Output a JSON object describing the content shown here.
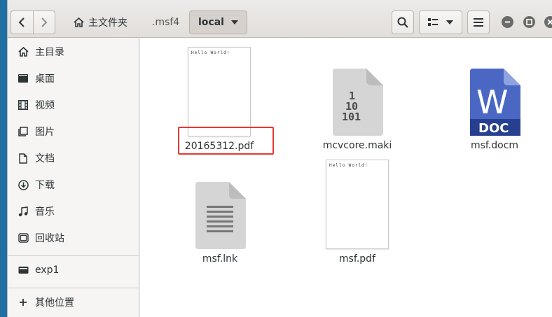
{
  "header": {
    "home_label": "主文件夹",
    "crumb_parent": ".msf4",
    "crumb_current": "local"
  },
  "sidebar": {
    "items": [
      {
        "label": "主目录",
        "icon": "home-icon"
      },
      {
        "label": "桌面",
        "icon": "desktop-icon"
      },
      {
        "label": "视频",
        "icon": "video-icon"
      },
      {
        "label": "图片",
        "icon": "picture-icon"
      },
      {
        "label": "文档",
        "icon": "document-icon"
      },
      {
        "label": "下载",
        "icon": "download-icon"
      },
      {
        "label": "音乐",
        "icon": "music-icon"
      },
      {
        "label": "回收站",
        "icon": "trash-icon"
      },
      {
        "label": "exp1",
        "icon": "drive-icon"
      },
      {
        "label": "其他位置",
        "icon": "plus-icon"
      }
    ]
  },
  "files": [
    {
      "name": "20165312.pdf",
      "type": "pdf",
      "thumb_text": "Hello World!"
    },
    {
      "name": "mcvcore.maki",
      "type": "binary",
      "thumb_text": "1\n10\n101"
    },
    {
      "name": "msf.docm",
      "type": "word",
      "thumb_text": "DOC"
    },
    {
      "name": "msf.lnk",
      "type": "text"
    },
    {
      "name": "msf.pdf",
      "type": "pdf",
      "thumb_text": "Hello World!"
    }
  ],
  "colors": {
    "highlight": "#e53935",
    "word_blue": "#3f5bb5",
    "word_dark": "#26408f"
  }
}
